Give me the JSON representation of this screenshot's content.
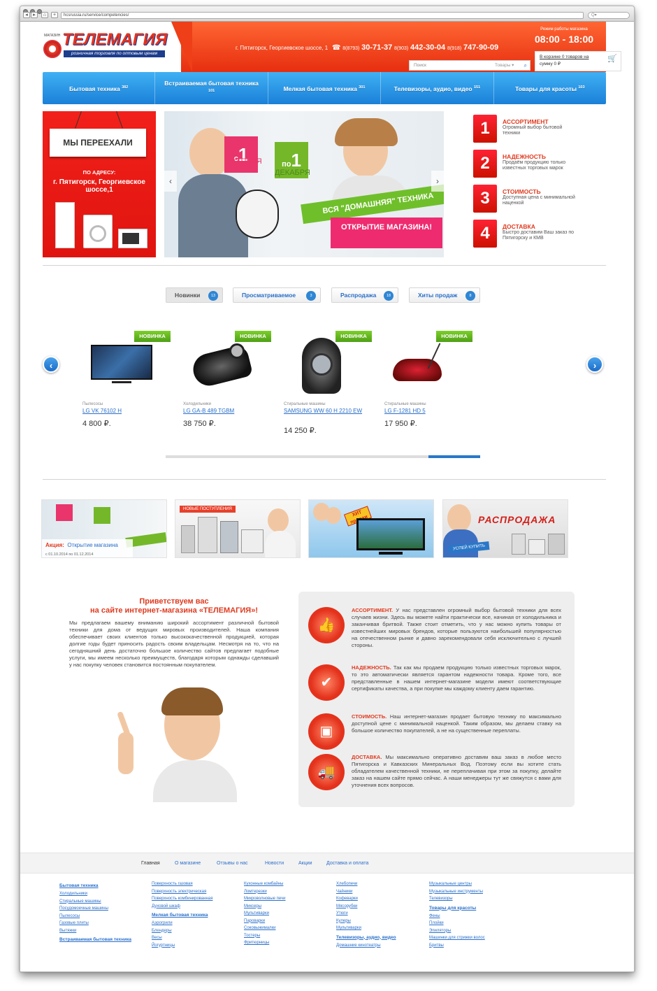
{
  "browser": {
    "url": "hcsrussia.ru/service/competencies/",
    "search_placeholder": "Q▾"
  },
  "header": {
    "logo_small": "МАГАЗИН",
    "logo": "ТЕЛЕМАГИЯ",
    "tagline": "розничная торговля по оптовым ценам",
    "address": "г. Пятигорск, Георгиевское шоссе, 1",
    "phone1_prefix": "8(8793)",
    "phone1": "30-71-37",
    "phone2_prefix": "8(903)",
    "phone2": "442-30-04",
    "phone3_prefix": "8(918)",
    "phone3": "747-90-09",
    "mode_label": "Режим работы магазина",
    "mode_value": "08:00 - 18:00",
    "search_placeholder": "Поиск",
    "search_select": "Товары",
    "cart_line1": "В корзине 0 товаров на",
    "cart_line2": "сумму 0 ₽"
  },
  "menu": [
    {
      "label": "Бытовая техника",
      "count": "382"
    },
    {
      "label": "Встраиваемая бытовая техника",
      "count": "101"
    },
    {
      "label": "Мелкая бытовая техника",
      "count": "301"
    },
    {
      "label": "Телевизоры, аудио, видео",
      "count": "151"
    },
    {
      "label": "Товары для красоты",
      "count": "103"
    }
  ],
  "moved": {
    "sign": "МЫ ПЕРЕЕХАЛИ",
    "by_address": "ПО АДРЕСУ:",
    "address": "г. Пятигорск, Георгиевское шоссе,1"
  },
  "slider": {
    "from": "с",
    "from_day": "1",
    "from_month": "ОКТЯБРЯ",
    "to": "по",
    "to_day": "1",
    "to_month": "ДЕКАБРЯ",
    "ribbon": "ВСЯ \"ДОМАШНЯЯ\" ТЕХНИКА",
    "open": "ОТКРЫТИЕ МАГАЗИНА!"
  },
  "features": [
    {
      "num": "1",
      "title": "АССОРТИМЕНТ",
      "desc": "Огромный выбор бытовой техники"
    },
    {
      "num": "2",
      "title": "НАДЕЖНОСТЬ",
      "desc": "Продаём продукцию только известных торговых марок"
    },
    {
      "num": "3",
      "title": "СТОИМОСТЬ",
      "desc": "Доступная цена с минимальной наценкой"
    },
    {
      "num": "4",
      "title": "ДОСТАВКА",
      "desc": "Быстро доставим Ваш заказ по Пятигорску и КМВ"
    }
  ],
  "tabs": [
    {
      "label": "Новинки",
      "count": "13"
    },
    {
      "label": "Просматриваемое",
      "count": "3"
    },
    {
      "label": "Распродажа",
      "count": "18"
    },
    {
      "label": "Хиты продаж",
      "count": "8"
    }
  ],
  "products": [
    {
      "badge": "НОВИНКА",
      "category": "Пылесосы",
      "name": "LG VK 76102 H",
      "price": "4 800 ₽."
    },
    {
      "badge": "НОВИНКА",
      "category": "Холодильники",
      "name": "LG GA-B 489 TGBM",
      "price": "38 750 ₽."
    },
    {
      "badge": "НОВИНКА",
      "category": "Стиральные машины",
      "name": "SAMSUNG WW 60 H 2210 EW",
      "price": "14 250 ₽."
    },
    {
      "badge": "НОВИНКА",
      "category": "Стиральные машины",
      "name": "LG F-1281 HD 5",
      "price": "17 950 ₽."
    }
  ],
  "banners": {
    "promo_label": "Акция:",
    "promo_title": "Открытие магазина",
    "promo_dates": "с 01.10.2014 по 01.12.2014",
    "new_arrivals": "НОВЫЕ ПОСТУПЛЕНИЯ",
    "hit": "ХИТ продаж",
    "sale": "РАСПРОДАЖА",
    "hurry": "УСПЕЙ КУПИТЬ"
  },
  "welcome": {
    "title1": "Приветствуем вас",
    "title2": "на сайте интернет-магазина «ТЕЛЕМАГИЯ»!",
    "text": "Мы предлагаем вашему вниманию широкий ассортимент различной бытовой техники для дома от ведущих мировых производителей. Наша компания обеспечивает своих клиентов только высококачественной продукцией, которая долгие годы будет приносить радость своим владельцам. Несмотря на то, что на сегодняшний день достаточно большое количество сайтов предлагает подобные услуги, мы имеем несколько преимуществ, благодаря которым однажды сделавший у нас покупку человек становится постоянным покупателем."
  },
  "info": [
    {
      "title": "АССОРТИМЕНТ.",
      "text": "У нас представлен огромный выбор бытовой техники для всех случаев жизни. Здесь вы можете найти практически все, начиная от холодильника и заканчивая бритвой. Также стоит отметить, что у нас можно купить товары от известнейших мировых брендов, которые пользуются наибольшей популярностью на отечественном рынке и давно зарекомендовали себя исключительно с лучшей стороны."
    },
    {
      "title": "НАДЕЖНОСТЬ.",
      "text": "Так как мы продаем продукцию только известных торговых марок, то это автоматически является гарантом надежности товара. Кроме того, все представленные в нашем интернет-магазине модели имеют соответствующие сертификаты качества, а при покупке мы каждому клиенту даем гарантию."
    },
    {
      "title": "СТОИМОСТЬ.",
      "text": "Наш интернет-магазин продает бытовую технику по максимально доступной цене с минимальной наценкой. Таким образом, мы делаем ставку на большое количество покупателей, а не на существенные переплаты."
    },
    {
      "title": "ДОСТАВКА.",
      "text": "Мы максимально оперативно доставим ваш заказ в любое место Пятигорска и Кавказских Минеральных Вод. Поэтому если вы хотите стать обладателем качественной техники, не переплачивая при этом за покупку, делайте заказ на нашем сайте прямо сейчас. А наши менеджеры тут же свяжутся с вами для уточнения всех вопросов."
    }
  ],
  "footer_nav": [
    "Главная",
    "О магазине",
    "Отзывы о нас",
    "Новости",
    "Акции",
    "Доставка и оплата"
  ],
  "footer_cols": [
    [
      {
        "t": "Бытовая техника",
        "h": true
      },
      {
        "t": "Холодильники"
      },
      {
        "t": "Стиральные машины"
      },
      {
        "t": "Посудомоечные машины"
      },
      {
        "t": "Пылесосы"
      },
      {
        "t": "Газовые плиты"
      },
      {
        "t": "Вытяжки"
      },
      {
        "t": "Встраиваемая бытовая техника",
        "h": true
      }
    ],
    [
      {
        "t": "Поверхность газовая"
      },
      {
        "t": "Поверхность электрическая"
      },
      {
        "t": "Поверхность комбинированная"
      },
      {
        "t": "Духовой шкаф"
      },
      {
        "t": "Мелкая бытовая техника",
        "h": true
      },
      {
        "t": "Аэрогрили"
      },
      {
        "t": "Блендеры"
      },
      {
        "t": "Весы"
      },
      {
        "t": "Йогуртницы"
      }
    ],
    [
      {
        "t": "Кухонные комбайны"
      },
      {
        "t": "Ломтерезки"
      },
      {
        "t": "Микроволновые печи"
      },
      {
        "t": "Миксеры"
      },
      {
        "t": "Мультиварки"
      },
      {
        "t": "Пароварки"
      },
      {
        "t": "Соковыжималки"
      },
      {
        "t": "Тостеры"
      },
      {
        "t": "Фритюрницы"
      }
    ],
    [
      {
        "t": "Хлебопечи"
      },
      {
        "t": "Чайники"
      },
      {
        "t": "Кофеварки"
      },
      {
        "t": "Мясорубки"
      },
      {
        "t": "Утюги"
      },
      {
        "t": "Кулеры"
      },
      {
        "t": "Мультиварки"
      },
      {
        "t": "Телевизоры, аудио, видео",
        "h": true
      },
      {
        "t": "Домашние кинотеатры"
      }
    ],
    [
      {
        "t": "Музыкальные центры"
      },
      {
        "t": "Музыкальные инструменты"
      },
      {
        "t": "Телевизоры"
      },
      {
        "t": "Товары для красоты",
        "h": true
      },
      {
        "t": "Фены"
      },
      {
        "t": "Плойки"
      },
      {
        "t": "Эпиляторы"
      },
      {
        "t": "Машинки для стрижки волос"
      },
      {
        "t": "Бритвы"
      }
    ]
  ]
}
